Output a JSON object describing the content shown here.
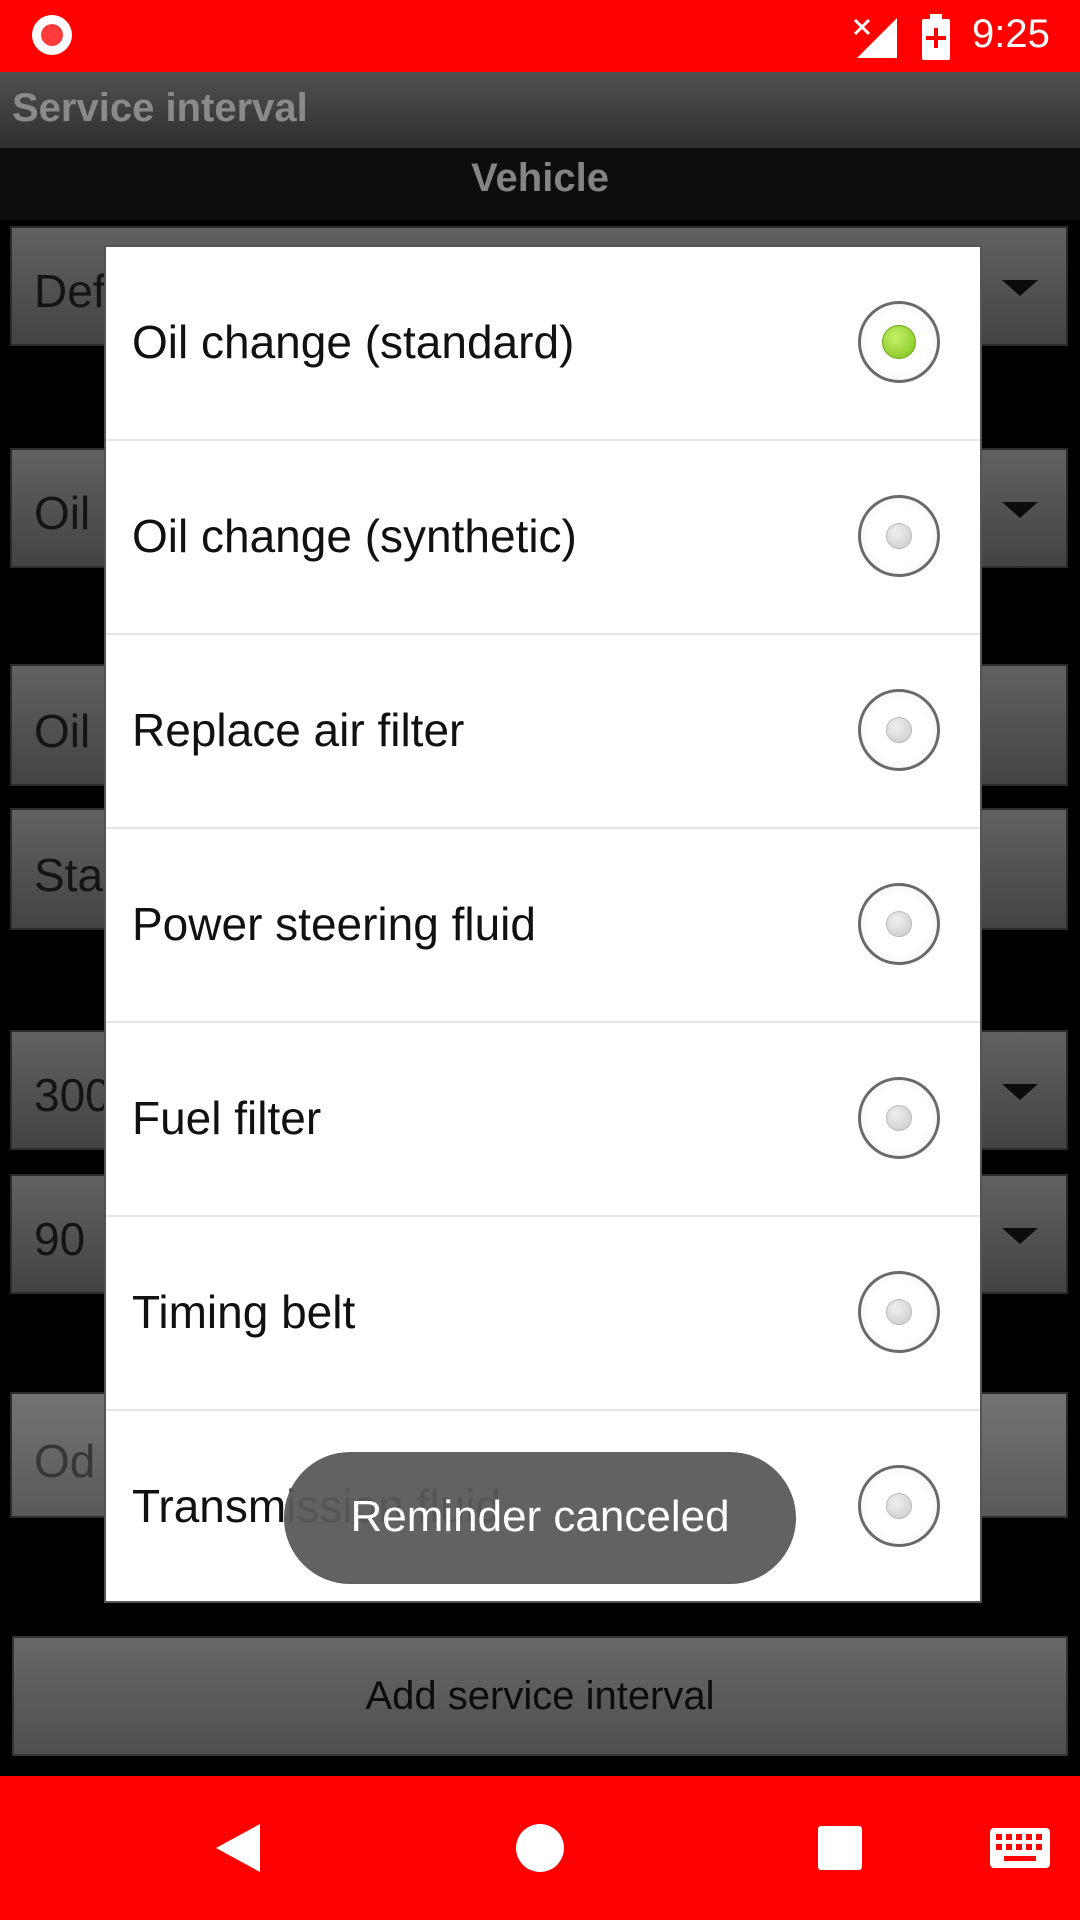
{
  "status_bar": {
    "time": "9:25",
    "icons": [
      "screen-record-icon",
      "signal-off-icon",
      "battery-charging-icon"
    ],
    "color": "#ff0000"
  },
  "app": {
    "title": "Service interval",
    "section_header": "Vehicle"
  },
  "form": {
    "fields": [
      {
        "value": "Def",
        "has_dropdown": true
      },
      {
        "value": "Oil",
        "has_dropdown": true
      },
      {
        "value": "Oil",
        "has_dropdown": false
      },
      {
        "value": "Sta",
        "has_dropdown": false
      },
      {
        "value": "300",
        "has_dropdown": true
      },
      {
        "value": "90",
        "has_dropdown": true
      },
      {
        "value": "Od",
        "has_dropdown": false
      }
    ],
    "add_button_label": "Add service interval"
  },
  "dialog": {
    "options": [
      {
        "label": "Oil change (standard)",
        "selected": true
      },
      {
        "label": "Oil change (synthetic)",
        "selected": false
      },
      {
        "label": "Replace air filter",
        "selected": false
      },
      {
        "label": "Power steering fluid",
        "selected": false
      },
      {
        "label": "Fuel filter",
        "selected": false
      },
      {
        "label": "Timing belt",
        "selected": false
      },
      {
        "label": "Transmission fluid",
        "selected": false
      }
    ]
  },
  "toast": {
    "message": "Reminder canceled"
  },
  "nav_bar": {
    "icons": [
      "back-icon",
      "home-icon",
      "recents-icon",
      "keyboard-icon"
    ],
    "color": "#ff0000"
  }
}
